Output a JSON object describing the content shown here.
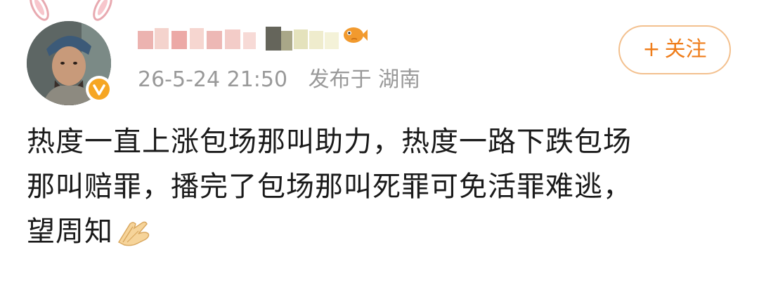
{
  "post": {
    "timestamp": "26-5-24 21:50",
    "location": "发布于 湖南",
    "follow_label": "关注",
    "follow_plus": "+",
    "content_lines": [
      "热度一直上涨包场那叫助力，热度一路下跌包场",
      "那叫赔罪，播完了包场那叫死罪可免活罪难逃，",
      "望周知"
    ]
  },
  "colors": {
    "accent": "#ef7d1a",
    "follow_border": "#f3c08e",
    "meta_text": "#999999",
    "body_text": "#1a1a1a",
    "verified_badge": "#f6a623"
  },
  "icons": {
    "ears": "bunny-ears-icon",
    "verified": "verified-badge-icon",
    "fish": "fish-icon",
    "emoji": "folded-hands-emoji-icon"
  }
}
